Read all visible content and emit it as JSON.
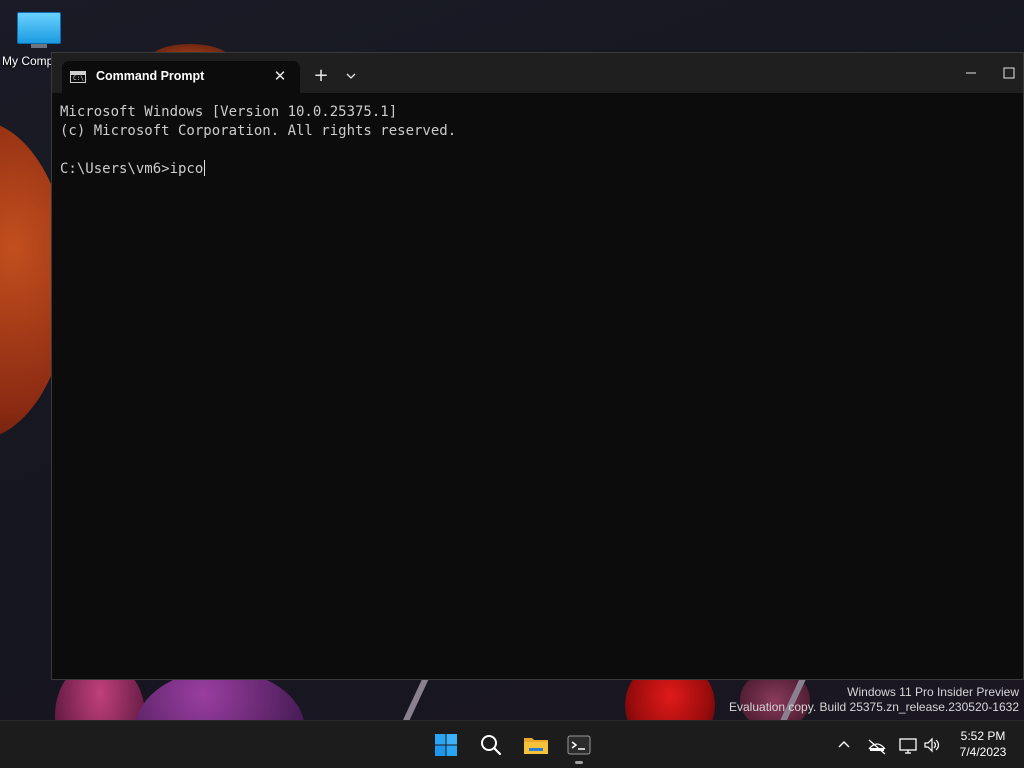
{
  "desktop": {
    "icons": [
      {
        "label": "My Comp",
        "icon": "monitor-icon"
      }
    ]
  },
  "window": {
    "tab_title": "Command Prompt",
    "tab_icon_text": "C:\\.",
    "close_tab_glyph": "✕",
    "new_tab_glyph": "+",
    "console_lines": [
      "Microsoft Windows [Version 10.0.25375.1]",
      "(c) Microsoft Corporation. All rights reserved.",
      "",
      "C:\\Users\\vm6>ipco"
    ]
  },
  "watermark": {
    "line1": "Windows 11 Pro Insider Preview",
    "line2": "Evaluation copy. Build 25375.zn_release.230520-1632"
  },
  "taskbar": {
    "apps": [
      "start-icon",
      "search-icon",
      "file-explorer-icon",
      "terminal-icon"
    ],
    "tray": [
      "chevron-up-icon",
      "network-disconnected-icon",
      "display-icon",
      "volume-icon"
    ],
    "time": "5:52 PM",
    "date": "7/4/2023"
  },
  "colors": {
    "console_bg": "#0c0c0c",
    "titlebar_bg": "#1f1f1f",
    "taskbar_bg": "#1c1c1c",
    "start_blue": "#2aa5f5",
    "folder_yellow": "#f5c23a"
  }
}
